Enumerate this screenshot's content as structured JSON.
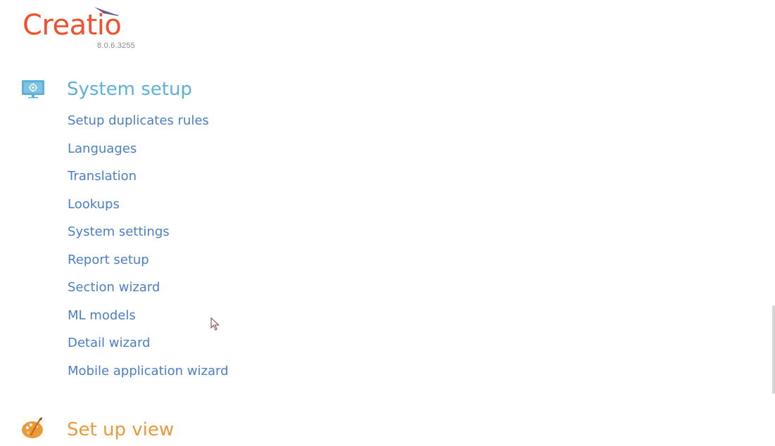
{
  "logo": {
    "wordmark": "Creatio",
    "version": "8.0.6.3255"
  },
  "colors": {
    "brand": "#f0502e",
    "system_setup_title": "#5fb0d7",
    "set_up_view_title": "#eb9a3b",
    "link": "#4a7fc6"
  },
  "sections": {
    "system_setup": {
      "title": "System setup",
      "icon": "monitor-gear-icon",
      "links": [
        "Setup duplicates rules",
        "Languages",
        "Translation",
        "Lookups",
        "System settings",
        "Report setup",
        "Section wizard",
        "ML models",
        "Detail wizard",
        "Mobile application wizard"
      ]
    },
    "set_up_view": {
      "title": "Set up view",
      "icon": "palette-brush-icon"
    }
  }
}
